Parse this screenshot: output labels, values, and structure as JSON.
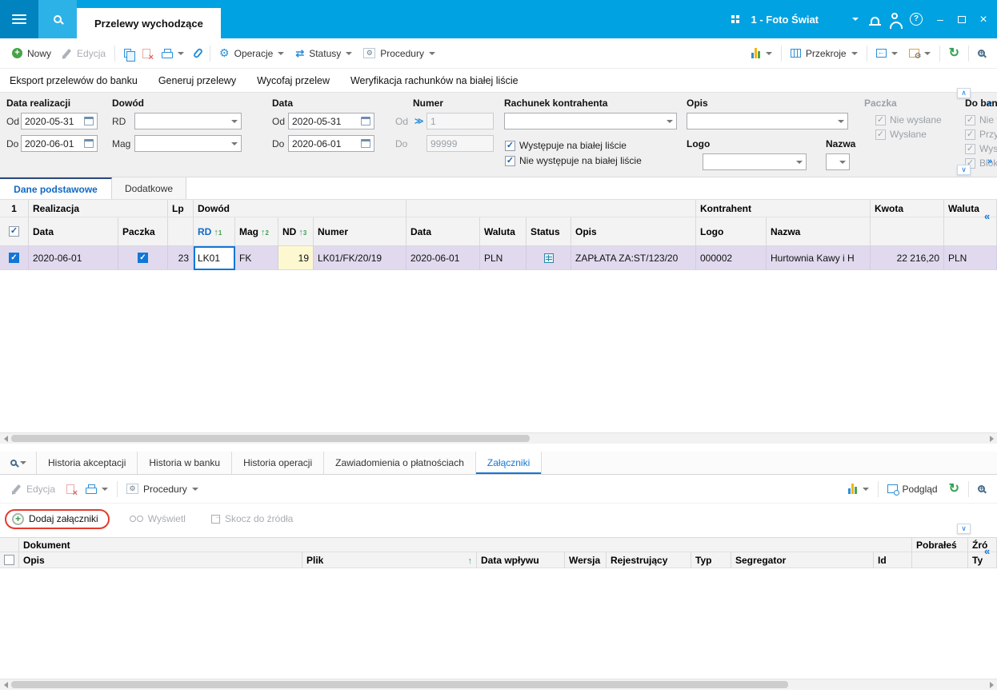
{
  "titlebar": {
    "tab_label": "Przelewy wychodzące",
    "company": "1 - Foto Świat"
  },
  "toolbar": {
    "nowy": "Nowy",
    "edycja": "Edycja",
    "operacje": "Operacje",
    "statusy": "Statusy",
    "procedury": "Procedury",
    "przekroje": "Przekroje"
  },
  "action_links": {
    "eksport": "Eksport przelewów do banku",
    "generuj": "Generuj przelewy",
    "wycofaj": "Wycofaj przelew",
    "weryfikacja": "Weryfikacja rachunków na białej liście"
  },
  "filters": {
    "data_realizacji": {
      "title": "Data realizacji",
      "od_label": "Od",
      "do_label": "Do",
      "od_value": "2020-05-31",
      "do_value": "2020-06-01"
    },
    "dowod": {
      "title": "Dowód",
      "rd_label": "RD",
      "mag_label": "Mag"
    },
    "data": {
      "title": "Data",
      "od_label": "Od",
      "do_label": "Do",
      "od_value": "2020-05-31",
      "do_value": "2020-06-01"
    },
    "numer": {
      "title": "Numer",
      "od_label": "Od",
      "do_label": "Do",
      "od_value": "1",
      "do_value": "99999"
    },
    "rachunek": {
      "title": "Rachunek kontrahenta",
      "check1": "Występuje na białej liście",
      "check2": "Nie występuje na białej liście"
    },
    "opis": {
      "title": "Opis"
    },
    "logo": {
      "title": "Logo"
    },
    "nazwa": {
      "title": "Nazwa"
    },
    "paczka": {
      "title": "Paczka",
      "check1": "Nie wysłane",
      "check2": "Wysłane"
    },
    "do_banku": {
      "title": "Do ban",
      "check1": "Nie v",
      "check2": "Przy",
      "check3": "Wysł",
      "check4": "Blok"
    }
  },
  "view_tabs": {
    "dane_podstawowe": "Dane podstawowe",
    "dodatkowe": "Dodatkowe"
  },
  "grid": {
    "row_number": "1",
    "groups": {
      "realizacja": "Realizacja",
      "lp": "Lp",
      "dowod": "Dowód",
      "kontrahent": "Kontrahent",
      "kwota": "Kwota",
      "waluta": "Waluta"
    },
    "cols": {
      "data": "Data",
      "paczka": "Paczka",
      "rd": "RD",
      "mag": "Mag",
      "nd": "ND",
      "numer": "Numer",
      "data2": "Data",
      "waluta": "Waluta",
      "status": "Status",
      "opis": "Opis",
      "logo": "Logo",
      "nazwa": "Nazwa"
    },
    "sort": {
      "rd": "1",
      "mag": "2",
      "nd": "3"
    },
    "row": {
      "data": "2020-06-01",
      "lp": "23",
      "rd": "LK01",
      "mag": "FK",
      "nd": "19",
      "numer": "LK01/FK/20/19",
      "data2": "2020-06-01",
      "waluta": "PLN",
      "opis": "ZAPŁATA ZA:ST/123/20",
      "logo": "000002",
      "nazwa": "Hurtownia Kawy i H",
      "kwota": "22 216,20",
      "waluta2": "PLN"
    }
  },
  "bottom": {
    "tabs": {
      "historia_akceptacji": "Historia akceptacji",
      "historia_w_banku": "Historia w banku",
      "historia_operacji": "Historia operacji",
      "zawiadomienia": "Zawiadomienia o płatnościach",
      "zalaczniki": "Załączniki"
    },
    "toolbar": {
      "edycja": "Edycja",
      "procedury": "Procedury",
      "podglad": "Podgląd"
    },
    "buttons": {
      "dodaj": "Dodaj załączniki",
      "wyswietl": "Wyświetl",
      "skocz": "Skocz do źródła"
    },
    "grid": {
      "dokument": "Dokument",
      "pobrales": "Pobrałeś",
      "zrodlo": "Źró",
      "cols": {
        "opis": "Opis",
        "plik": "Plik",
        "data_wplywu": "Data wpływu",
        "wersja": "Wersja",
        "rejestrujacy": "Rejestrujący",
        "typ": "Typ",
        "segregator": "Segregator",
        "id": "Id",
        "ty": "Ty"
      }
    }
  }
}
